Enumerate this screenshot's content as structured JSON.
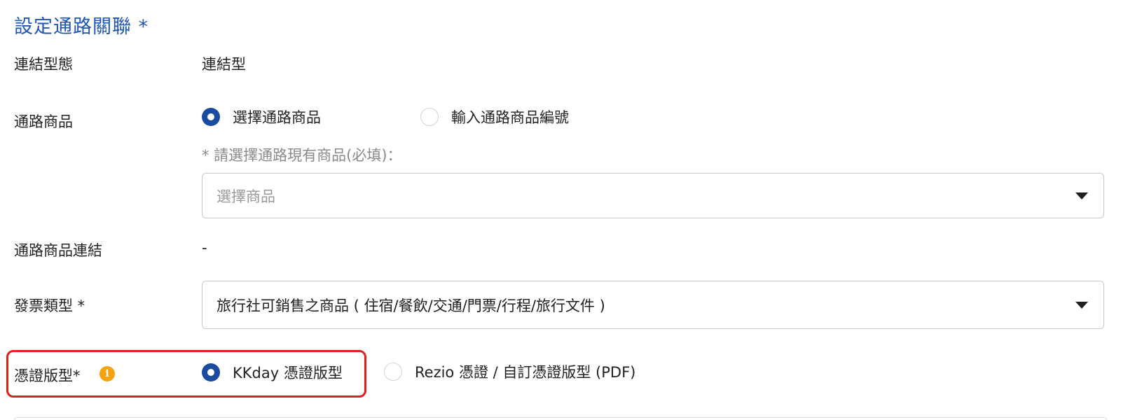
{
  "section": {
    "title": "設定通路關聯 *"
  },
  "link_type": {
    "label": "連結型態",
    "value": "連結型"
  },
  "channel_product": {
    "label": "通路商品",
    "options": [
      {
        "label": "選擇通路商品",
        "selected": true
      },
      {
        "label": "輸入通路商品編號",
        "selected": false
      }
    ],
    "hint": "* 請選擇通路現有商品(必填)：",
    "select_placeholder": "選擇商品"
  },
  "channel_link": {
    "label": "通路商品連結",
    "value": "-"
  },
  "invoice_type": {
    "label": "發票類型 *",
    "value": "旅行社可銷售之商品 ( 住宿/餐飲/交通/門票/行程/旅行文件 )"
  },
  "voucher_template": {
    "label": "憑證版型*",
    "info_icon": "i",
    "options": [
      {
        "label": "KKday 憑證版型",
        "selected": true
      },
      {
        "label": "Rezio 憑證 / 自訂憑證版型 (PDF)",
        "selected": false
      }
    ]
  },
  "colors": {
    "accent": "#1a4ba0",
    "title": "#1e56b4",
    "highlight": "#e0201b",
    "info": "#f5a410"
  }
}
